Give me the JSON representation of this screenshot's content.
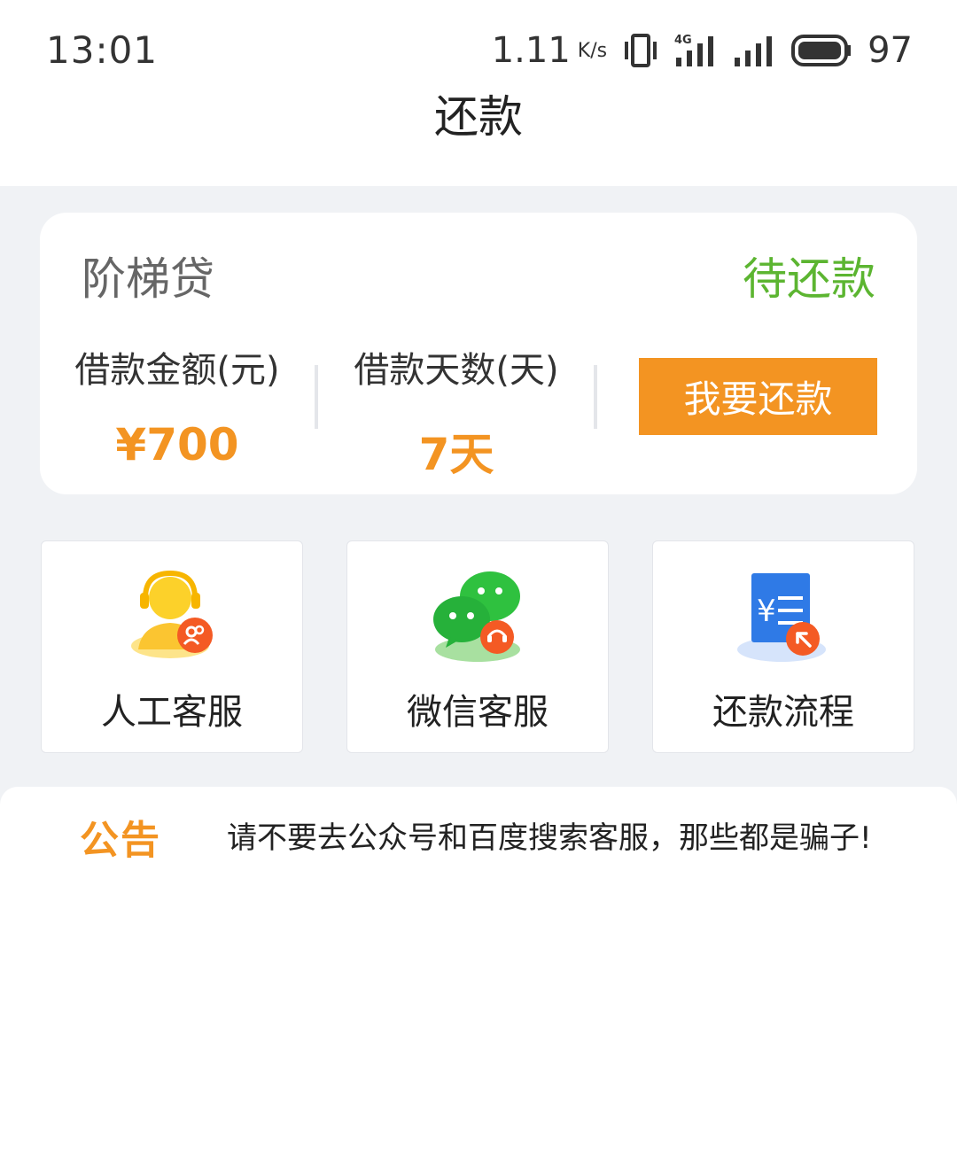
{
  "status_bar": {
    "time": "13:01",
    "net_speed": "1.11",
    "net_unit": "K/s",
    "battery": "97"
  },
  "header": {
    "title": "还款"
  },
  "loan": {
    "product_name": "阶梯贷",
    "status": "待还款",
    "status_color": "#5cb531",
    "amount_label": "借款金额(元)",
    "amount_value": "¥700",
    "days_label": "借款天数(天)",
    "days_value": "7天",
    "repay_button": "我要还款",
    "accent_color": "#f39422"
  },
  "services": [
    {
      "label": "人工客服",
      "icon": "customer-service-agent-icon"
    },
    {
      "label": "微信客服",
      "icon": "wechat-chat-icon"
    },
    {
      "label": "还款流程",
      "icon": "repayment-process-icon"
    }
  ],
  "notice": {
    "tag": "公告",
    "text": "请不要去公众号和百度搜索客服，那些都是骗子!"
  }
}
